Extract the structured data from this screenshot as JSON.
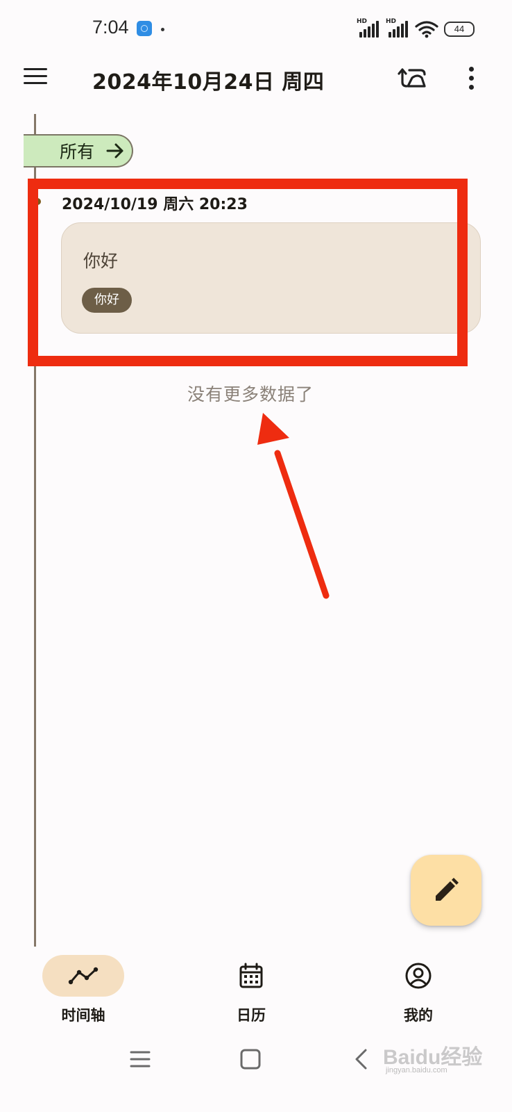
{
  "status_bar": {
    "time": "7:04",
    "signal1_label": "HD",
    "signal2_label": "HD",
    "battery": "44",
    "app_icon": "app-notification-icon"
  },
  "app_bar": {
    "title": "2024年10月24日 周四",
    "menu_icon": "hamburger-menu-icon",
    "sync_icon": "sync-icon",
    "more_icon": "more-vertical-icon"
  },
  "filter": {
    "label": "所有",
    "icon": "arrow-right-icon",
    "color": "#cdeabd"
  },
  "entries": [
    {
      "timestamp": "2024/10/19 周六 20:23",
      "content": "你好",
      "tag": "你好"
    }
  ],
  "list_end_text": "没有更多数据了",
  "annotation": {
    "highlight_color": "#ee2c10"
  },
  "fab": {
    "icon": "pencil-icon",
    "color": "#fddfa5"
  },
  "bottom_nav": {
    "items": [
      {
        "label": "时间轴",
        "icon": "timeline-icon",
        "active": true
      },
      {
        "label": "日历",
        "icon": "calendar-icon",
        "active": false
      },
      {
        "label": "我的",
        "icon": "account-icon",
        "active": false
      }
    ]
  },
  "system_nav": {
    "menu_icon": "system-menu-icon",
    "home_icon": "system-home-icon",
    "back_icon": "system-back-icon"
  },
  "watermark": {
    "text": "Baidu经验",
    "sub": "jingyan.baidu.com"
  }
}
